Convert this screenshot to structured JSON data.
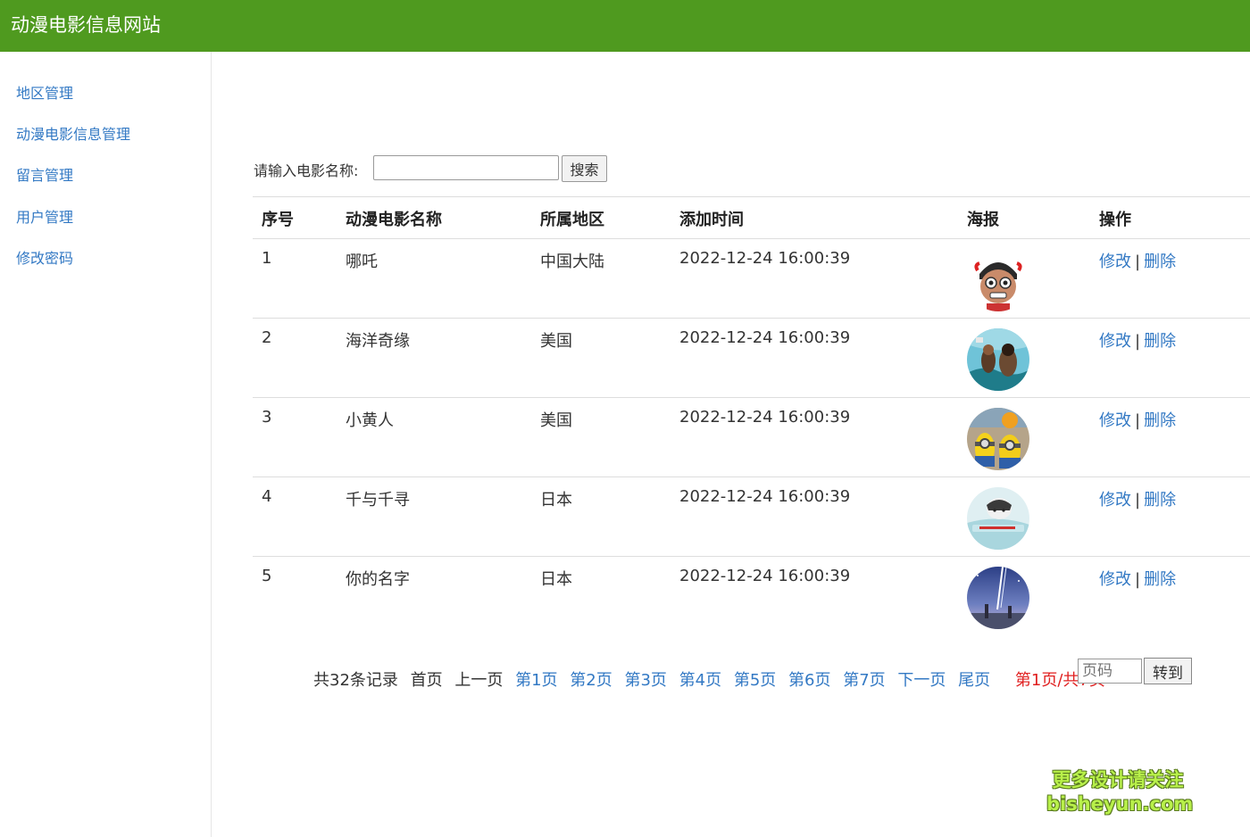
{
  "header": {
    "title": "动漫电影信息网站"
  },
  "sidebar": {
    "items": [
      {
        "label": "地区管理"
      },
      {
        "label": "动漫电影信息管理"
      },
      {
        "label": "留言管理"
      },
      {
        "label": "用户管理"
      },
      {
        "label": "修改密码"
      }
    ]
  },
  "search": {
    "label": "请输入电影名称:",
    "value": "",
    "button": "搜索"
  },
  "table": {
    "columns": [
      "序号",
      "动漫电影名称",
      "所属地区",
      "添加时间",
      "海报",
      "操作"
    ],
    "rows": [
      {
        "index": "1",
        "name": "哪吒",
        "region": "中国大陆",
        "time": "2022-12-24 16:00:39"
      },
      {
        "index": "2",
        "name": "海洋奇缘",
        "region": "美国",
        "time": "2022-12-24 16:00:39"
      },
      {
        "index": "3",
        "name": "小黄人",
        "region": "美国",
        "time": "2022-12-24 16:00:39"
      },
      {
        "index": "4",
        "name": "千与千寻",
        "region": "日本",
        "time": "2022-12-24 16:00:39"
      },
      {
        "index": "5",
        "name": "你的名字",
        "region": "日本",
        "time": "2022-12-24 16:00:39"
      }
    ],
    "edit_label": "修改",
    "separator": "|",
    "delete_label": "删除"
  },
  "pager": {
    "total": "共32条记录",
    "first": "首页",
    "prev": "上一页",
    "pages": [
      "第1页",
      "第2页",
      "第3页",
      "第4页",
      "第5页",
      "第6页",
      "第7页"
    ],
    "next": "下一页",
    "last": "尾页",
    "current": "第1页/共7页",
    "jump_placeholder": "页码",
    "jump_button": "转到"
  },
  "watermark": {
    "line1": "更多设计请关注",
    "line2": "bisheyun.com"
  },
  "colors": {
    "header": "#4f9a1f",
    "link": "#3379c4",
    "current_page": "#e02020"
  }
}
